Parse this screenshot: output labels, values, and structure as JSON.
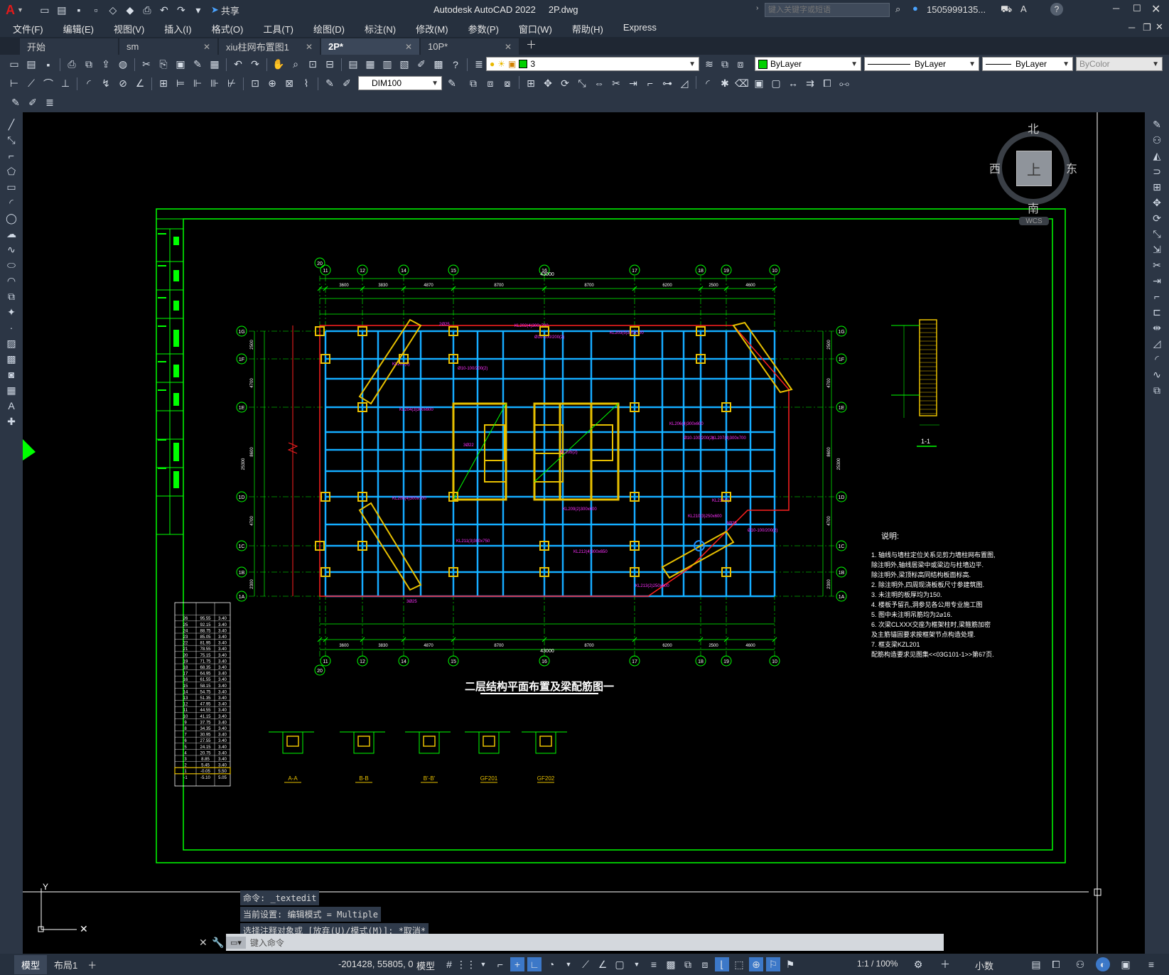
{
  "app": {
    "logo": "A",
    "title": "Autodesk AutoCAD 2022",
    "filename": "2P.dwg",
    "search_placeholder": "键入关键字或短语",
    "user": "1505999135...",
    "share": "共享"
  },
  "menu": [
    "文件(F)",
    "编辑(E)",
    "视图(V)",
    "插入(I)",
    "格式(O)",
    "工具(T)",
    "绘图(D)",
    "标注(N)",
    "修改(M)",
    "参数(P)",
    "窗口(W)",
    "帮助(H)",
    "Express"
  ],
  "tabs": [
    {
      "label": "开始",
      "active": false
    },
    {
      "label": "sm",
      "active": false
    },
    {
      "label": "xiu柱网布置图1",
      "active": false
    },
    {
      "label": "2P*",
      "active": true
    },
    {
      "label": "10P*",
      "active": false
    }
  ],
  "toolbar": {
    "layer_value": "3",
    "color_value": "ByLayer",
    "linetype_value": "ByLayer",
    "lineweight_value": "ByLayer",
    "plotstyle_value": "ByColor",
    "dimstyle_value": "DIM100"
  },
  "viewcube": {
    "north": "北",
    "south": "南",
    "east": "东",
    "west": "西",
    "top": "上",
    "wcs": "WCS"
  },
  "drawing": {
    "title": "二层结构平面布置及梁配筋图一",
    "notes_title": "说明:",
    "notes": [
      "1. 轴线与墙柱定位关系见剪力墙柱网布置图,",
      "   除注明外,轴线居梁中或梁边与柱墙边平.",
      "   除注明外,梁顶标高同结构板面标高.",
      "2. 除注明外,四周现浇板板尺寸参建筑图.",
      "3. 未注明的板厚均为150.",
      "4. 楼板予留孔,洞参见各公用专业施工图",
      "5. 图中未注明吊筋均为2⌀16.",
      "6. 次梁CLXXX交座为框架柱时,梁箍筋加密",
      "   及主筋锚固要求按框架节点构造处理.",
      "7. 框支梁KZL201",
      "   配筋构造要求见图集<<03G101-1>>第67页."
    ],
    "section_label": "1-1",
    "detail_labels": [
      "A-A",
      "B-B",
      "B'-B'",
      "GF201",
      "GF202"
    ],
    "overall_dim": "43000",
    "top_dims": [
      "3600",
      "3830",
      "4870",
      "8700",
      "8700",
      "6200",
      "2500",
      "4600"
    ],
    "axes_top": [
      "20",
      "11",
      "12",
      "14",
      "15",
      "16",
      "17",
      "18",
      "19",
      "10"
    ],
    "axes_left": [
      "1G",
      "1F",
      "1E",
      "1D",
      "1C",
      "1B",
      "1A"
    ],
    "left_dims": [
      "2500",
      "4700",
      "8600",
      "4700",
      "2300"
    ],
    "total_height": "25300",
    "floor_table": [
      [
        "26",
        "95.55",
        "3.40"
      ],
      [
        "25",
        "92.15",
        "3.40"
      ],
      [
        "24",
        "88.75",
        "3.40"
      ],
      [
        "23",
        "85.05",
        "3.40"
      ],
      [
        "22",
        "81.95",
        "3.40"
      ],
      [
        "21",
        "78.55",
        "3.40"
      ],
      [
        "20",
        "75.15",
        "3.40"
      ],
      [
        "19",
        "71.75",
        "3.40"
      ],
      [
        "18",
        "68.35",
        "3.40"
      ],
      [
        "17",
        "64.95",
        "3.40"
      ],
      [
        "16",
        "61.55",
        "3.40"
      ],
      [
        "15",
        "58.15",
        "3.40"
      ],
      [
        "14",
        "54.75",
        "3.40"
      ],
      [
        "13",
        "51.35",
        "3.40"
      ],
      [
        "12",
        "47.95",
        "3.40"
      ],
      [
        "11",
        "44.55",
        "3.40"
      ],
      [
        "10",
        "41.15",
        "3.40"
      ],
      [
        "9",
        "37.75",
        "3.40"
      ],
      [
        "8",
        "34.35",
        "3.40"
      ],
      [
        "7",
        "30.95",
        "3.40"
      ],
      [
        "6",
        "27.55",
        "3.40"
      ],
      [
        "5",
        "24.15",
        "3.40"
      ],
      [
        "4",
        "20.75",
        "3.40"
      ],
      [
        "3",
        "8.85",
        "3.40"
      ],
      [
        "2",
        "5.45",
        "3.40"
      ],
      [
        "1",
        "-0.05",
        "5.50"
      ],
      [
        "-1",
        "-5.10",
        "5.05"
      ]
    ]
  },
  "command": {
    "history": [
      "命令: _textedit",
      "当前设置: 编辑模式 = Multiple",
      "选择注释对象或 [放弃(U)/模式(M)]: *取消*"
    ],
    "placeholder": "键入命令"
  },
  "status": {
    "model_tab": "模型",
    "layout_tab": "布局1",
    "coords": "-201428, 55805, 0",
    "model_label": "模型",
    "scale": "1:1 / 100%",
    "units": "小数"
  }
}
